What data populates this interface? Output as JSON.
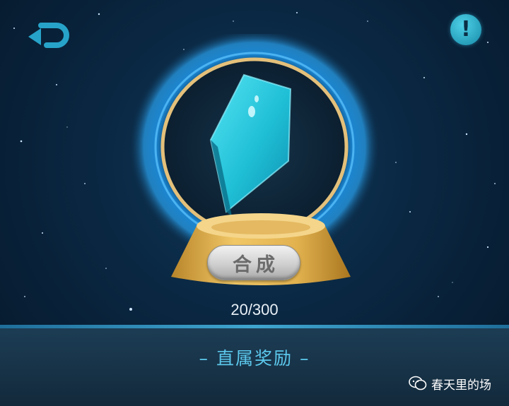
{
  "header": {
    "back_icon": "back-arrow-icon",
    "info_icon": "exclamation-icon",
    "info_symbol": "!"
  },
  "crystal": {
    "icon": "crystal-shard-icon",
    "color": "#1fbfd6"
  },
  "synthesize_button": {
    "label": "合成"
  },
  "progress": {
    "text": "20/300",
    "current": 20,
    "total": 300
  },
  "rewards_section": {
    "title": "– 直属奖励 –"
  },
  "watermark": {
    "text": "春天里的场",
    "icon": "wechat-chat-icon"
  },
  "colors": {
    "background": "#0a2742",
    "ring_glow": "#2aa3f0",
    "pedestal_gold": "#e2b24f",
    "accent_text": "#5cc8ec"
  }
}
